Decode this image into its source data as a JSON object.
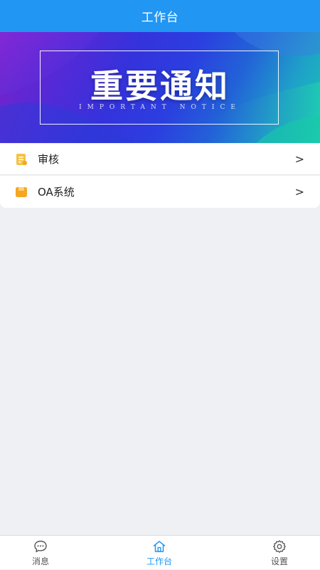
{
  "header": {
    "title": "工作台"
  },
  "banner": {
    "title": "重要通知",
    "subtitle": "IMPORTANT NOTICE"
  },
  "menu": {
    "items": [
      {
        "label": "审核",
        "icon": "document-icon",
        "arrow": ">"
      },
      {
        "label": "OA系统",
        "icon": "folder-icon",
        "arrow": ">"
      }
    ]
  },
  "tabbar": {
    "tabs": [
      {
        "label": "消息",
        "icon": "chat-icon",
        "active": false
      },
      {
        "label": "工作台",
        "icon": "home-icon",
        "active": true
      },
      {
        "label": "设置",
        "icon": "gear-icon",
        "active": false
      }
    ]
  },
  "colors": {
    "header": "#2196f3",
    "active_tab": "#2196f3",
    "background": "#eff0f4",
    "menu_icon_yellow": "#f5c242",
    "menu_icon_orange": "#f5a623"
  }
}
